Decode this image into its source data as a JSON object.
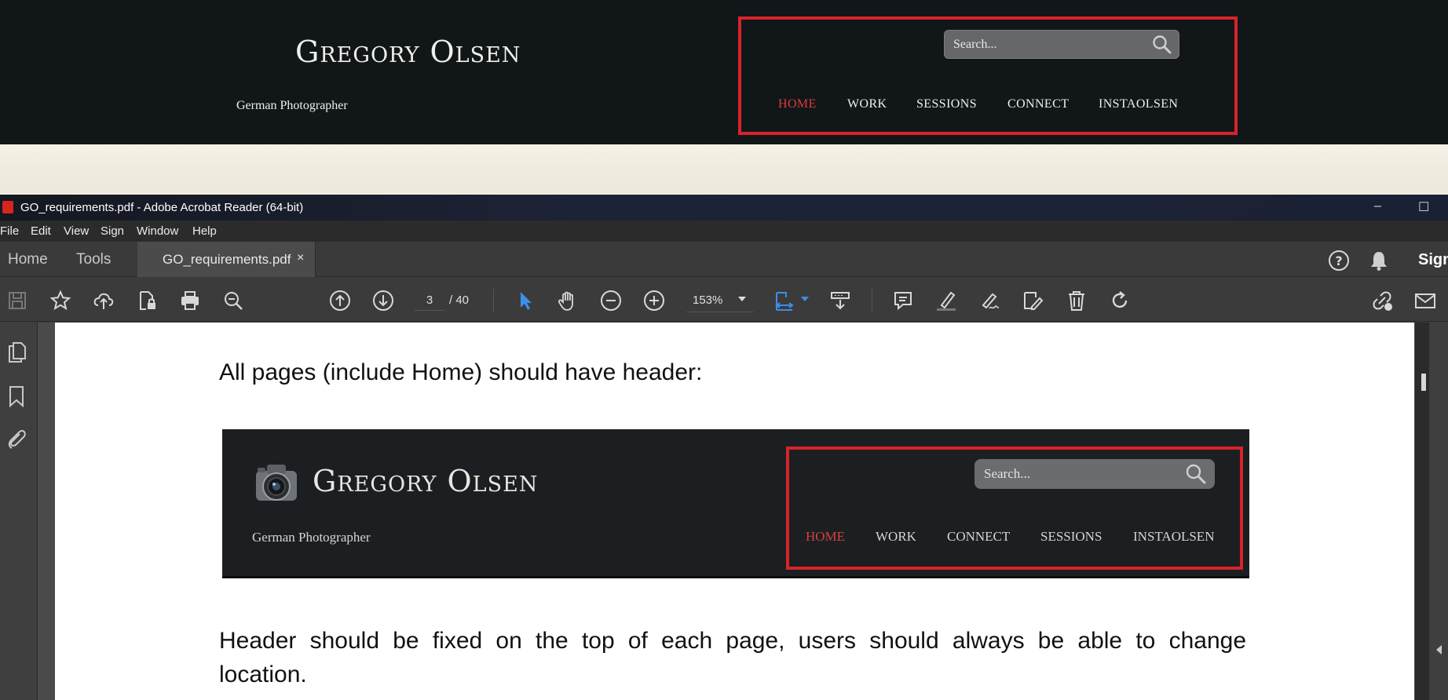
{
  "site": {
    "title": "Gregory Olsen",
    "subtitle": "German Photographer",
    "search_placeholder": "Search...",
    "nav": [
      "HOME",
      "WORK",
      "SESSIONS",
      "CONNECT",
      "INSTAOLSEN"
    ],
    "active_color": "#e03a3a",
    "highlight_color": "#d9222a"
  },
  "acrobat": {
    "window_title": "GO_requirements.pdf - Adobe Acrobat Reader (64-bit)",
    "window_controls": {
      "minimize": "–",
      "maximize": "☐"
    },
    "menu": [
      "File",
      "Edit",
      "View",
      "Sign",
      "Window",
      "Help"
    ],
    "tabs": {
      "home": "Home",
      "tools": "Tools",
      "document": "GO_requirements.pdf",
      "close": "×"
    },
    "sign_in": "Sign",
    "page_current": "3",
    "page_total": "/ 40",
    "zoom": "153%",
    "toolbar_icons": [
      "save-icon",
      "star-icon",
      "upload-icon",
      "file-lock-icon",
      "print-icon",
      "search-zoom-icon",
      "page-up-icon",
      "page-down-icon",
      "select-arrow-icon",
      "hand-icon",
      "zoom-out-icon",
      "zoom-in-icon",
      "fit-page-icon",
      "scroll-mode-icon",
      "comment-icon",
      "highlight-icon",
      "sign-pen-icon",
      "edit-icon",
      "delete-icon",
      "rotate-icon",
      "share-link-icon",
      "email-icon"
    ]
  },
  "pdf": {
    "heading": "All pages (include Home) should have header:",
    "embedded": {
      "title": "Gregory Olsen",
      "subtitle": "German Photographer",
      "search_placeholder": "Search...",
      "nav": [
        "HOME",
        "WORK",
        "CONNECT",
        "SESSIONS",
        "INSTAOLSEN"
      ]
    },
    "paragraph": "Header should be fixed on the top of each page, users should always be able to change location."
  }
}
